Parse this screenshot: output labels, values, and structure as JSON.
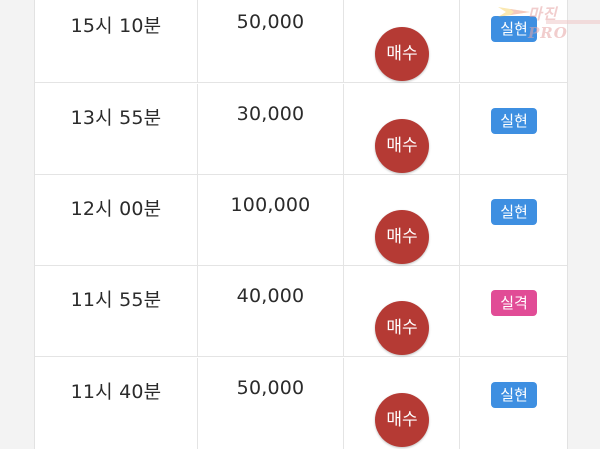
{
  "watermark": {
    "text": "마진 PRO"
  },
  "actions": {
    "buy_label": "매수"
  },
  "colors": {
    "buy_button": "#b53a34",
    "result_success": "#3e8fe1",
    "result_fail": "#e14c96"
  },
  "rows": [
    {
      "time": "15시 10분",
      "amount": "50,000",
      "action": "매수",
      "result": "실현",
      "status": "success"
    },
    {
      "time": "13시 55분",
      "amount": "30,000",
      "action": "매수",
      "result": "실현",
      "status": "success"
    },
    {
      "time": "12시 00분",
      "amount": "100,000",
      "action": "매수",
      "result": "실현",
      "status": "success"
    },
    {
      "time": "11시 55분",
      "amount": "40,000",
      "action": "매수",
      "result": "실격",
      "status": "fail"
    },
    {
      "time": "11시 40분",
      "amount": "50,000",
      "action": "매수",
      "result": "실현",
      "status": "success"
    }
  ]
}
